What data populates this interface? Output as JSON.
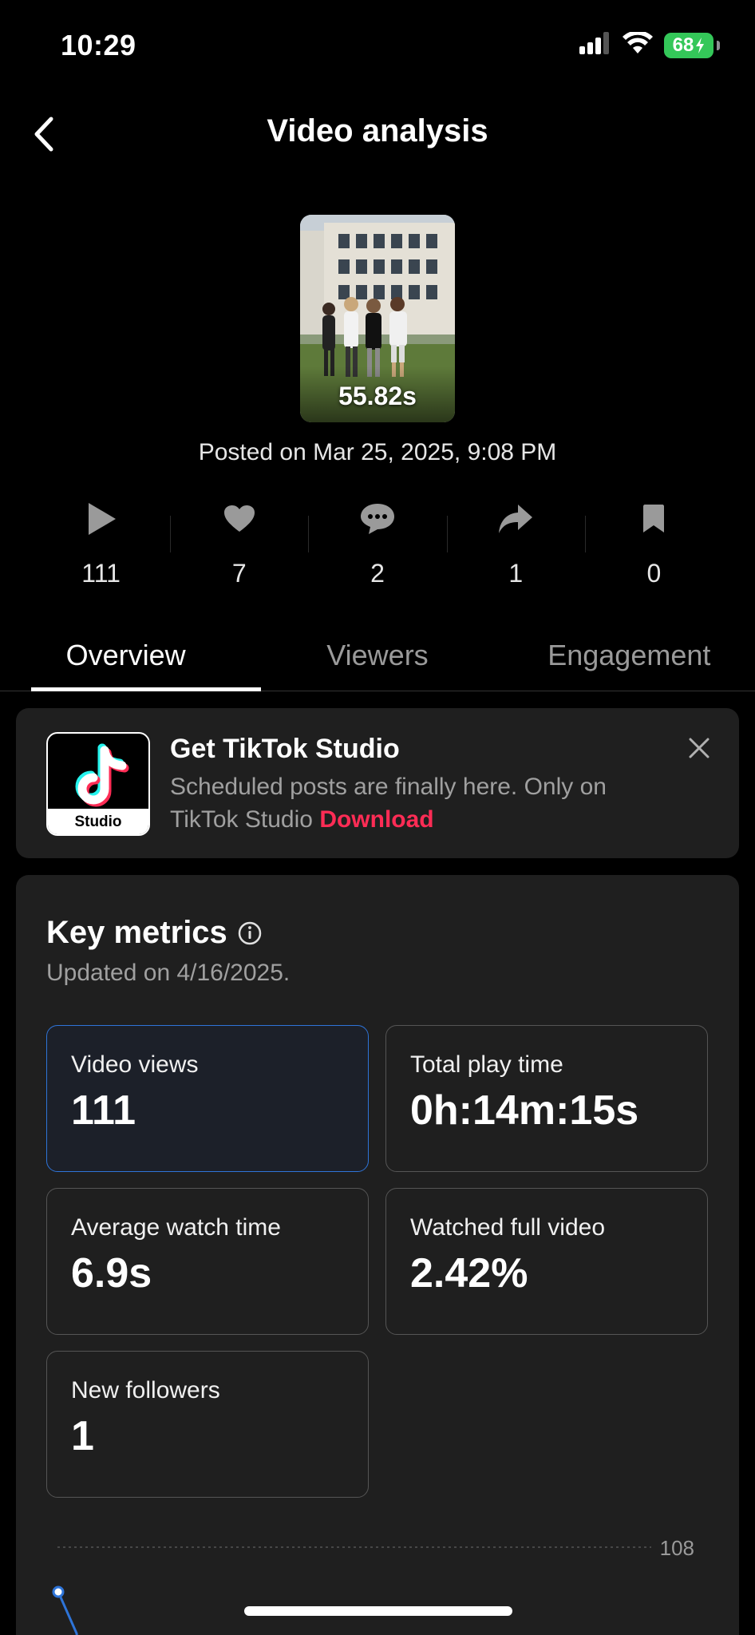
{
  "status_bar": {
    "time": "10:29",
    "battery": "68",
    "battery_color": "#34c759",
    "icons": [
      "cellular-signal-icon",
      "wifi-icon",
      "charging-bolt-icon"
    ]
  },
  "header": {
    "title": "Video analysis",
    "back_icon": "chevron-left-icon"
  },
  "video": {
    "duration": "55.82s",
    "posted": "Posted on Mar 25, 2025, 9:08 PM"
  },
  "stats": [
    {
      "icon": "play-icon",
      "value": "111"
    },
    {
      "icon": "heart-icon",
      "value": "7"
    },
    {
      "icon": "comment-icon",
      "value": "2"
    },
    {
      "icon": "share-icon",
      "value": "1"
    },
    {
      "icon": "bookmark-icon",
      "value": "0"
    }
  ],
  "tabs": [
    {
      "label": "Overview",
      "active": true
    },
    {
      "label": "Viewers",
      "active": false
    },
    {
      "label": "Engagement",
      "active": false
    }
  ],
  "promo": {
    "title": "Get TikTok Studio",
    "text": "Scheduled posts are finally here. Only on TikTok Studio",
    "link": "Download",
    "logo_label": "Studio",
    "link_color": "#fe2c55"
  },
  "metrics": {
    "title": "Key metrics",
    "updated": "Updated on 4/16/2025.",
    "tiles": [
      {
        "label": "Video views",
        "value": "111",
        "selected": true
      },
      {
        "label": "Total play time",
        "value": "0h:14m:15s",
        "selected": false
      },
      {
        "label": "Average watch time",
        "value": "6.9s",
        "selected": false
      },
      {
        "label": "Watched full video",
        "value": "2.42%",
        "selected": false
      },
      {
        "label": "New followers",
        "value": "1",
        "selected": false
      }
    ],
    "selected_color": "#2e74d8",
    "chart_max_label": "108"
  }
}
